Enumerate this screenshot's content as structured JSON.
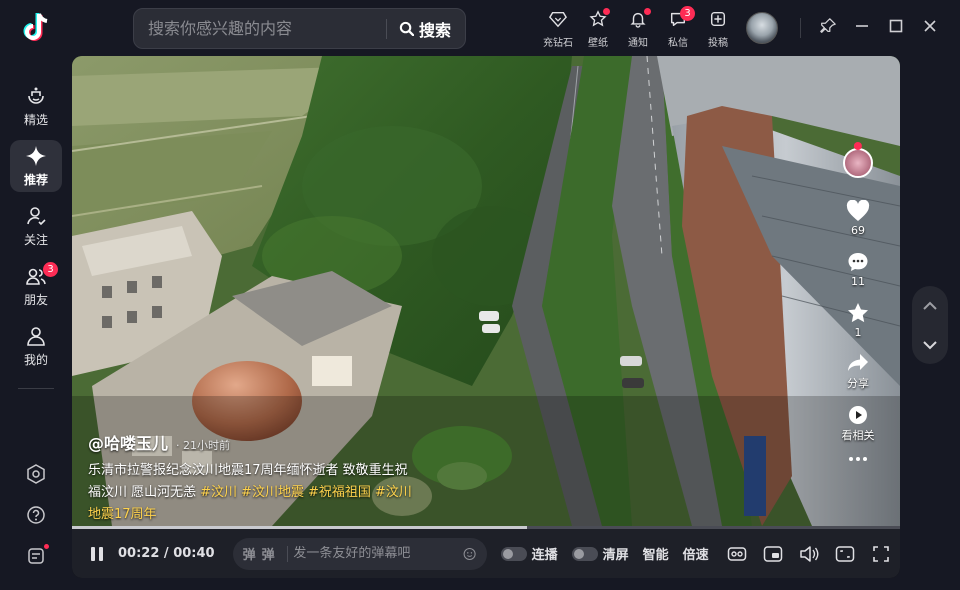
{
  "search": {
    "placeholder": "搜索你感兴趣的内容",
    "button_label": "搜索"
  },
  "top_icons": [
    {
      "label": "充钻石",
      "icon": "diamond-icon"
    },
    {
      "label": "壁纸",
      "icon": "wallpaper-icon"
    },
    {
      "label": "通知",
      "icon": "bell-icon"
    },
    {
      "label": "私信",
      "icon": "message-icon",
      "badge": "3"
    },
    {
      "label": "投稿",
      "icon": "upload-icon"
    }
  ],
  "sidebar": {
    "items": [
      {
        "label": "精选",
        "icon": "featured-icon"
      },
      {
        "label": "推荐",
        "icon": "recommend-icon",
        "active": true
      },
      {
        "label": "关注",
        "icon": "follow-icon"
      },
      {
        "label": "朋友",
        "icon": "friends-icon",
        "badge": "3"
      },
      {
        "label": "我的",
        "icon": "profile-icon"
      }
    ]
  },
  "video": {
    "author": "@哈喽玉儿",
    "time": "· 21小时前",
    "description": "乐清市拉警报纪念汶川地震17周年缅怀逝者 致敬重生祝福汶川 愿山河无恙",
    "tags": [
      "#汶川",
      "#汶川地震",
      "#祝福祖国",
      "#汶川地震17周年"
    ],
    "likes": "69",
    "comments": "11",
    "favorites": "1",
    "share_label": "分享",
    "related_label": "看相关",
    "progress": 0.55
  },
  "controls": {
    "time_current": "00:22",
    "time_total": "00:40",
    "danmu_icon_label_1": "弹",
    "danmu_icon_label_2": "弹",
    "danmu_placeholder": "发一条友好的弹幕吧",
    "continuous_label": "连播",
    "clear_label": "清屏",
    "smart_label": "智能",
    "speed_label": "倍速"
  },
  "colors": {
    "accent": "#fe2c55",
    "tag": "#ffd34d",
    "background": "#161823"
  }
}
